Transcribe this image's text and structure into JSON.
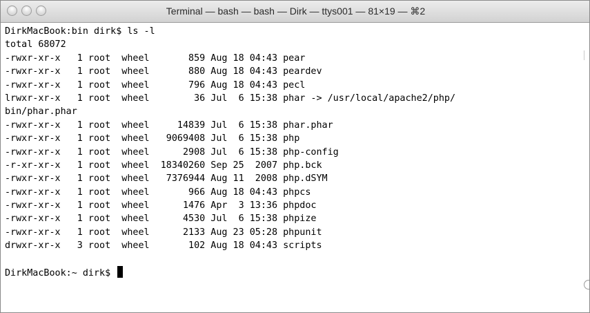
{
  "window": {
    "title": "Terminal — bash — bash — Dirk — ttys001 — 81×19 — ⌘2"
  },
  "terminal": {
    "lines": [
      "DirkMacBook:bin dirk$ ls -l",
      "total 68072",
      "-rwxr-xr-x   1 root  wheel       859 Aug 18 04:43 pear",
      "-rwxr-xr-x   1 root  wheel       880 Aug 18 04:43 peardev",
      "-rwxr-xr-x   1 root  wheel       796 Aug 18 04:43 pecl",
      "lrwxr-xr-x   1 root  wheel        36 Jul  6 15:38 phar -> /usr/local/apache2/php/",
      "bin/phar.phar",
      "-rwxr-xr-x   1 root  wheel     14839 Jul  6 15:38 phar.phar",
      "-rwxr-xr-x   1 root  wheel   9069408 Jul  6 15:38 php",
      "-rwxr-xr-x   1 root  wheel      2908 Jul  6 15:38 php-config",
      "-r-xr-xr-x   1 root  wheel  18340260 Sep 25  2007 php.bck",
      "-rwxr-xr-x   1 root  wheel   7376944 Aug 11  2008 php.dSYM",
      "-rwxr-xr-x   1 root  wheel       966 Aug 18 04:43 phpcs",
      "-rwxr-xr-x   1 root  wheel      1476 Apr  3 13:36 phpdoc",
      "-rwxr-xr-x   1 root  wheel      4530 Jul  6 15:38 phpize",
      "-rwxr-xr-x   1 root  wheel      2133 Aug 23 05:28 phpunit",
      "drwxr-xr-x   3 root  wheel       102 Aug 18 04:43 scripts",
      ""
    ],
    "prompt": "DirkMacBook:~ dirk$ "
  }
}
